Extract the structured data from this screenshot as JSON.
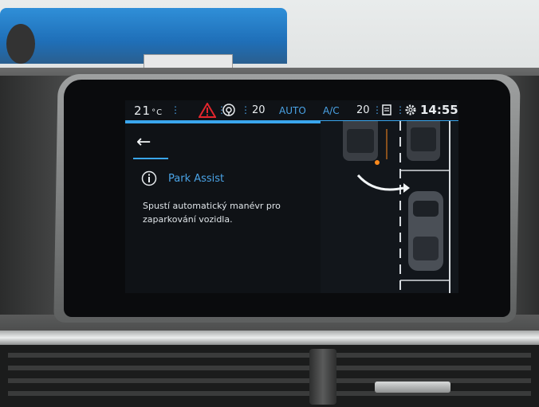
{
  "status": {
    "temp_left": "21",
    "temp_unit": "°C",
    "fan_speed": "20",
    "auto": "AUTO",
    "ac": "A/C",
    "temp_right": "20",
    "time": "14:55"
  },
  "page": {
    "back": "←",
    "heading": "Park Assist",
    "description_line1": "Spustí automatický manévr pro",
    "description_line2": "zaparkování vozidla."
  },
  "icons": {
    "warning": "warning-triangle-icon",
    "fan": "fan-icon",
    "seat": "seat-heat-icon",
    "settings": "gear-icon",
    "info": "info-icon"
  },
  "colors": {
    "accent": "#3aa6ee",
    "warning": "#e3262d",
    "screen_bg": "#0f1216"
  }
}
